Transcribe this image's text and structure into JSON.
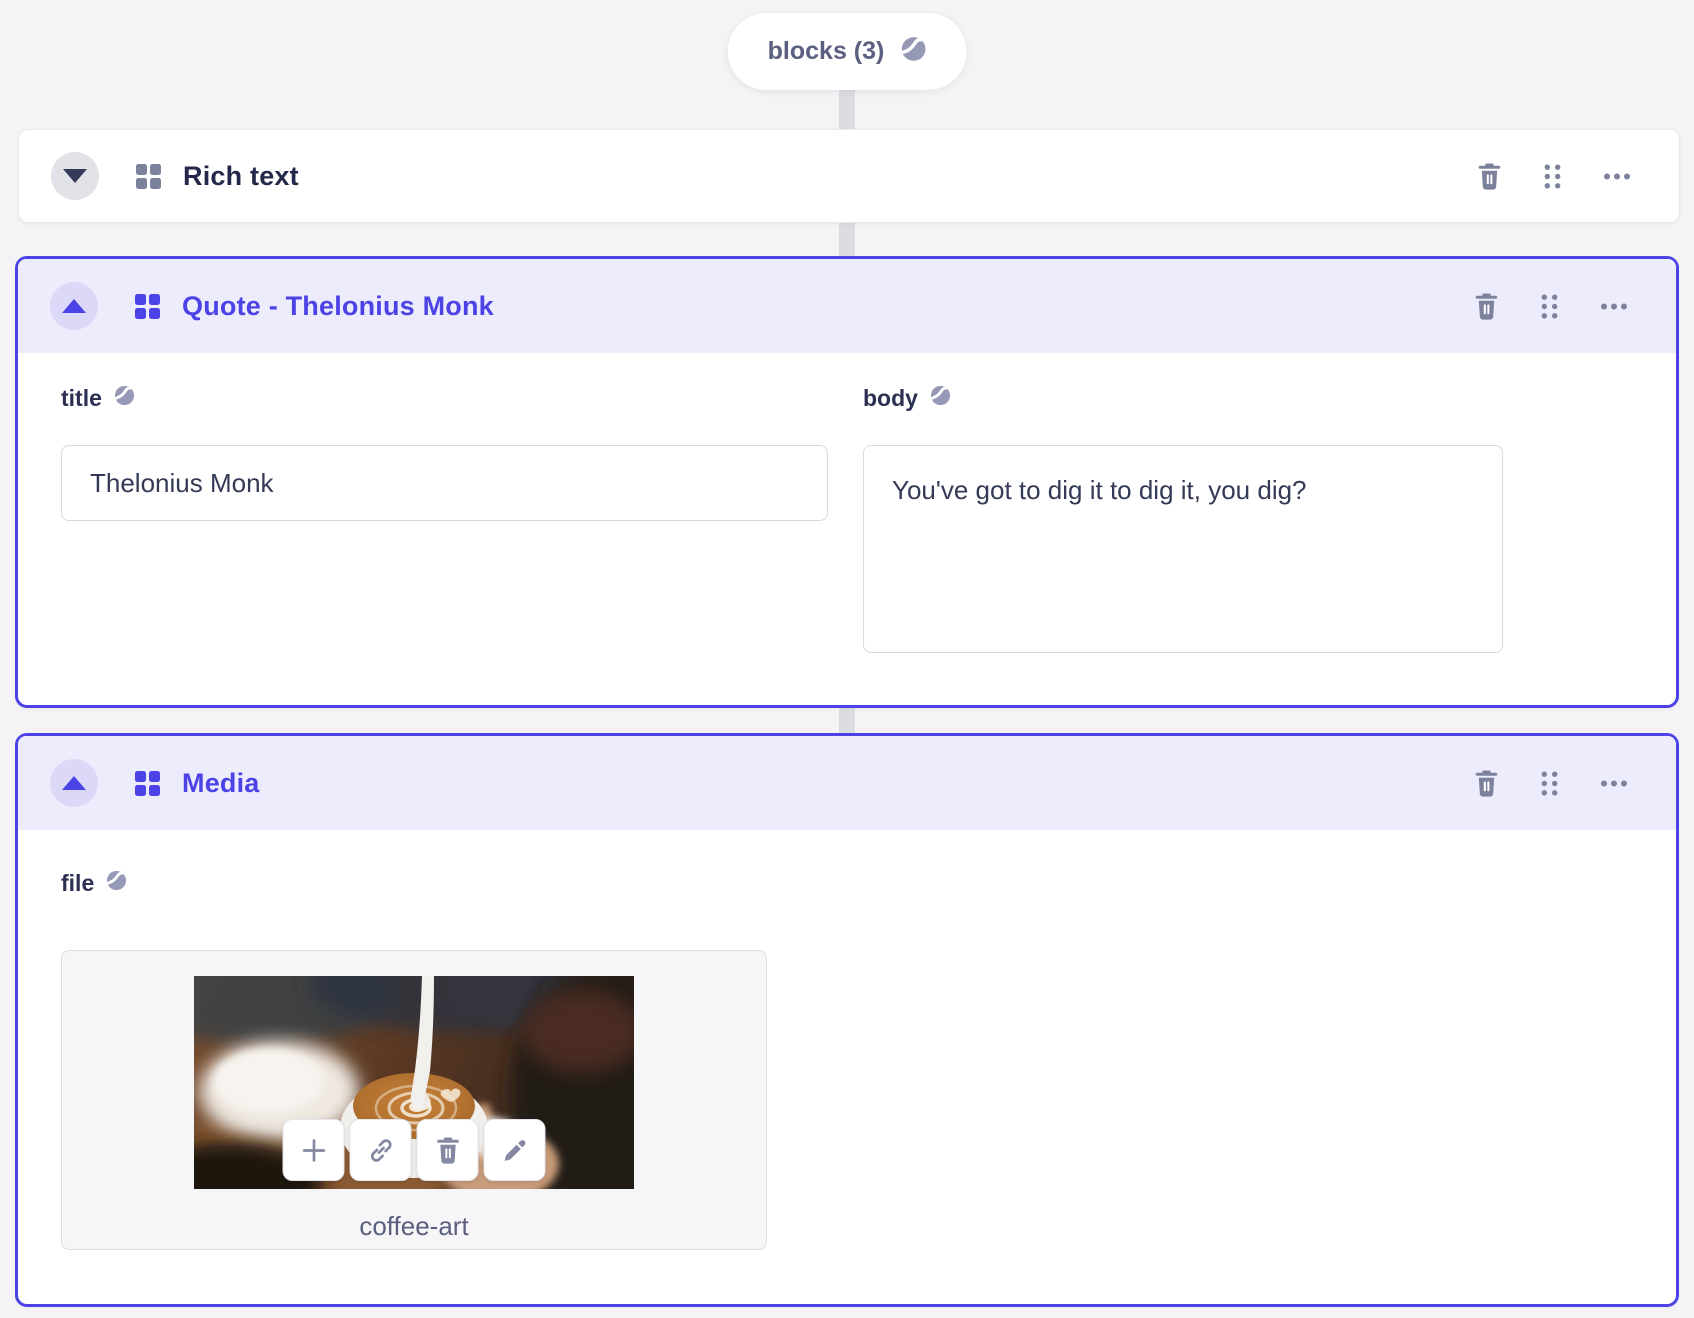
{
  "app": {
    "accent_color": "#4c43e7",
    "selected_header_color": "#edecfc",
    "page_background": "#f4f4f6",
    "icon_color": "#7d829c"
  },
  "blocks_field": {
    "label": "blocks (3)",
    "icon": "globe-icon"
  },
  "header_action_icons": [
    "trash-icon",
    "drag-handle-icon",
    "ellipsis-icon"
  ],
  "blocks": [
    {
      "title": "Rich text",
      "state": "collapsed",
      "type_icon": "blocks-grid-icon",
      "toggle_icon": "chevron-down-icon"
    },
    {
      "title": "Quote - Thelonius Monk",
      "state": "expanded-selected",
      "type_icon": "blocks-grid-icon",
      "toggle_icon": "chevron-up-icon",
      "fields": {
        "title": {
          "label": "title",
          "label_icon": "globe-icon",
          "value": "Thelonius Monk"
        },
        "body": {
          "label": "body",
          "label_icon": "globe-icon",
          "value": "You've got to dig it to dig it, you dig?"
        }
      }
    },
    {
      "title": "Media",
      "state": "expanded-selected",
      "type_icon": "blocks-grid-icon",
      "toggle_icon": "chevron-up-icon",
      "fields": {
        "file": {
          "label": "file",
          "label_icon": "globe-icon",
          "filename": "coffee-art",
          "preview": "latte-art-coffee-photo",
          "action_icons": [
            "plus-icon",
            "link-icon",
            "trash-icon",
            "pencil-icon"
          ]
        }
      }
    }
  ]
}
